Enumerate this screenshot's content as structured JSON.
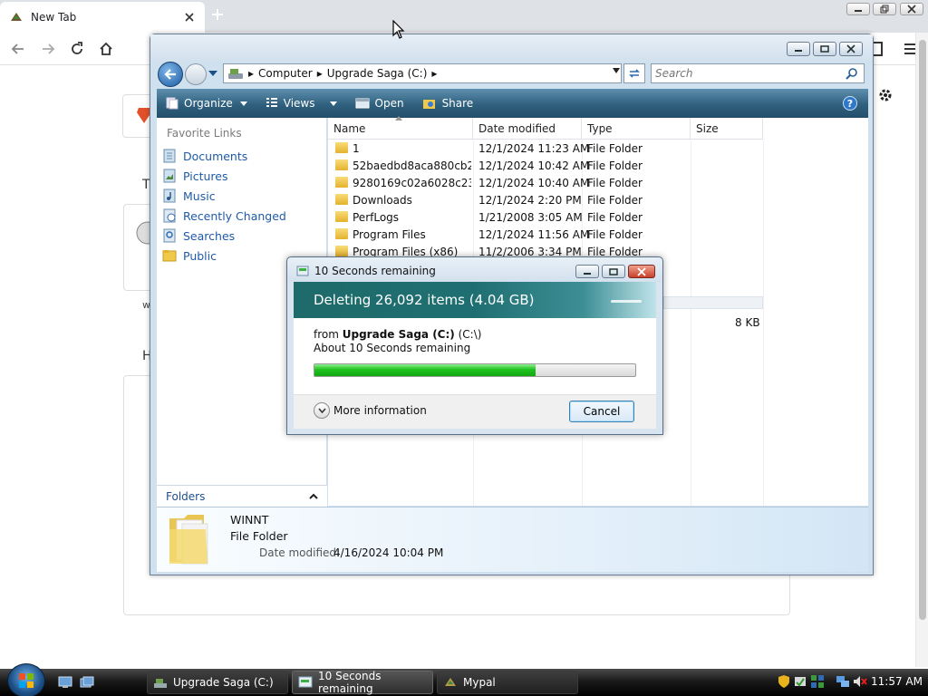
{
  "browser": {
    "tab_title": "New Tab",
    "newtab_partial": {
      "t_letter": "T",
      "w_letter": "w",
      "h_letter": "H"
    }
  },
  "explorer": {
    "breadcrumb": [
      "Computer",
      "Upgrade Saga (C:)"
    ],
    "search_placeholder": "Search",
    "commands": {
      "organize": "Organize",
      "views": "Views",
      "open": "Open",
      "share": "Share"
    },
    "nav": {
      "header": "Favorite Links",
      "items": [
        "Documents",
        "Pictures",
        "Music",
        "Recently Changed",
        "Searches",
        "Public"
      ],
      "folders_label": "Folders"
    },
    "columns": [
      "Name",
      "Date modified",
      "Type",
      "Size"
    ],
    "rows": [
      {
        "name": "1",
        "date": "12/1/2024 11:23 AM",
        "type": "File Folder"
      },
      {
        "name": "52baedbd8aca880cb2c...",
        "date": "12/1/2024 10:42 AM",
        "type": "File Folder"
      },
      {
        "name": "9280169c02a6028c232f94",
        "date": "12/1/2024 10:40 AM",
        "type": "File Folder"
      },
      {
        "name": "Downloads",
        "date": "12/1/2024 2:20 PM",
        "type": "File Folder"
      },
      {
        "name": "PerfLogs",
        "date": "1/21/2008 3:05 AM",
        "type": "File Folder"
      },
      {
        "name": "Program Files",
        "date": "12/1/2024 11:56 AM",
        "type": "File Folder"
      },
      {
        "name": "Program Files (x86)",
        "date": "11/2/2006 3:34 PM",
        "type": "File Folder"
      }
    ],
    "partial_size": "8 KB",
    "details": {
      "name": "WINNT",
      "type": "File Folder",
      "date_label": "Date modified:",
      "date_value": "4/16/2024 10:04 PM"
    }
  },
  "dialog": {
    "title": "10 Seconds remaining",
    "heading": "Deleting 26,092 items (4.04 GB)",
    "from_prefix": "from ",
    "from_bold": "Upgrade Saga (C:)",
    "from_suffix": " (C:\\)",
    "remaining": "About 10 Seconds remaining",
    "progress": 0.69,
    "more_info": "More information",
    "cancel": "Cancel"
  },
  "taskbar": {
    "buttons": [
      "Upgrade Saga (C:)",
      "10 Seconds remaining",
      "Mypal"
    ],
    "clock": "11:57 AM"
  }
}
